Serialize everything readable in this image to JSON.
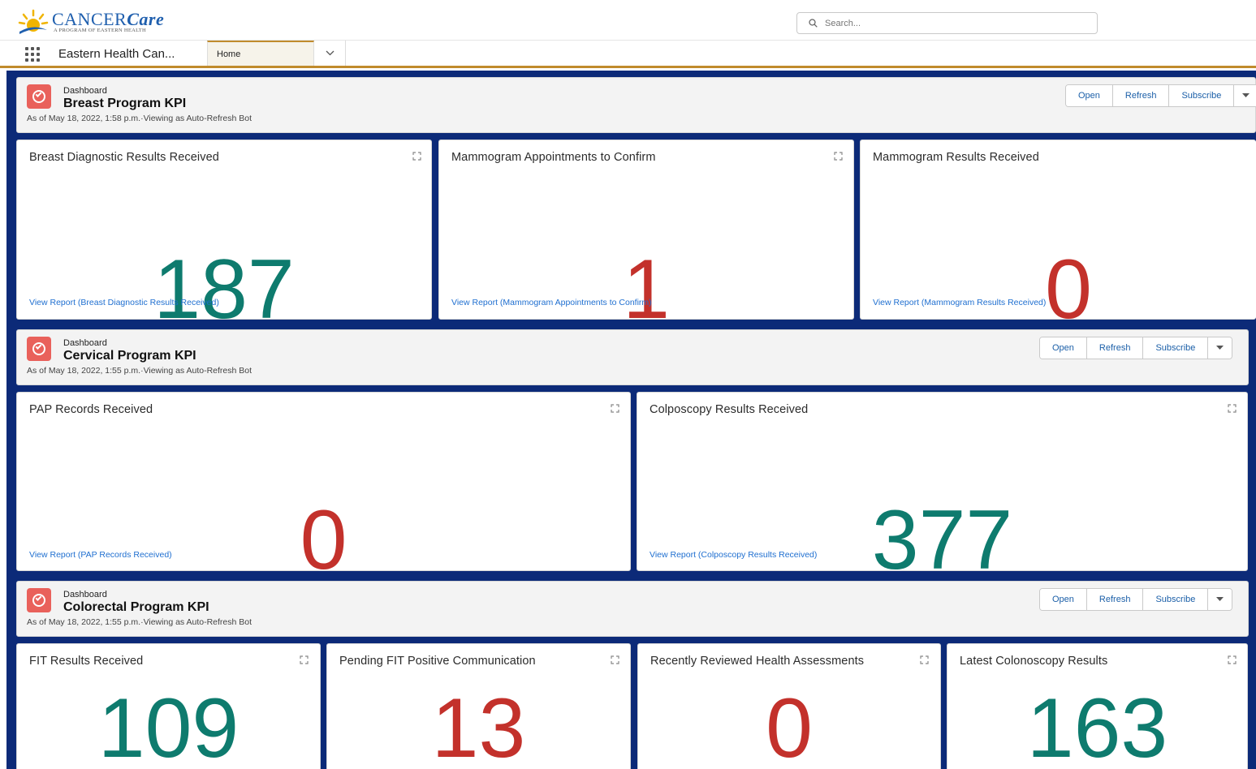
{
  "header": {
    "logo_name": "CANCER",
    "logo_name_script": "Care",
    "logo_tagline": "A PROGRAM OF EASTERN HEALTH",
    "search_placeholder": "Search..."
  },
  "nav": {
    "app_name": "Eastern Health Can...",
    "tab_home": "Home"
  },
  "dashboards": [
    {
      "label": "Dashboard",
      "title": "Breast Program KPI",
      "as_of": "As of May 18, 2022, 1:58 p.m.·Viewing as Auto-Refresh Bot",
      "buttons": {
        "open": "Open",
        "refresh": "Refresh",
        "subscribe": "Subscribe"
      },
      "cards": [
        {
          "title": "Breast Diagnostic Results Received",
          "value": "187",
          "link": "View Report (Breast Diagnostic Results Received)"
        },
        {
          "title": "Mammogram Appointments to Confirm",
          "value": "1",
          "link": "View Report (Mammogram Appointments to Confirm)"
        },
        {
          "title": "Mammogram Results Received",
          "value": "0",
          "link": "View Report (Mammogram Results Received)"
        }
      ]
    },
    {
      "label": "Dashboard",
      "title": "Cervical Program KPI",
      "as_of": "As of May 18, 2022, 1:55 p.m.·Viewing as Auto-Refresh Bot",
      "buttons": {
        "open": "Open",
        "refresh": "Refresh",
        "subscribe": "Subscribe"
      },
      "cards": [
        {
          "title": "PAP Records Received",
          "value": "0",
          "link": "View Report (PAP Records Received)"
        },
        {
          "title": "Colposcopy Results Received",
          "value": "377",
          "link": "View Report (Colposcopy Results Received)"
        }
      ]
    },
    {
      "label": "Dashboard",
      "title": "Colorectal Program KPI",
      "as_of": "As of May 18, 2022, 1:55 p.m.·Viewing as Auto-Refresh Bot",
      "buttons": {
        "open": "Open",
        "refresh": "Refresh",
        "subscribe": "Subscribe"
      },
      "cards": [
        {
          "title": "FIT Results Received",
          "value": "109"
        },
        {
          "title": "Pending FIT Positive Communication",
          "value": "13"
        },
        {
          "title": "Recently Reviewed Health Assessments",
          "value": "0"
        },
        {
          "title": "Latest Colonoscopy Results",
          "value": "163"
        }
      ]
    }
  ],
  "colors": {
    "metric_green": "#0e7b6e",
    "metric_red": "#c3312b",
    "page_background": "#0c2a78",
    "dashboard_icon": "#e9615b",
    "link": "#1f6fd0",
    "nav_accent": "#c08b2c"
  },
  "icons": [
    "sun-logo-icon",
    "search-icon",
    "app-launcher-icon",
    "chevron-down-icon",
    "dashboard-gauge-icon",
    "expand-icon",
    "caret-down-icon"
  ]
}
